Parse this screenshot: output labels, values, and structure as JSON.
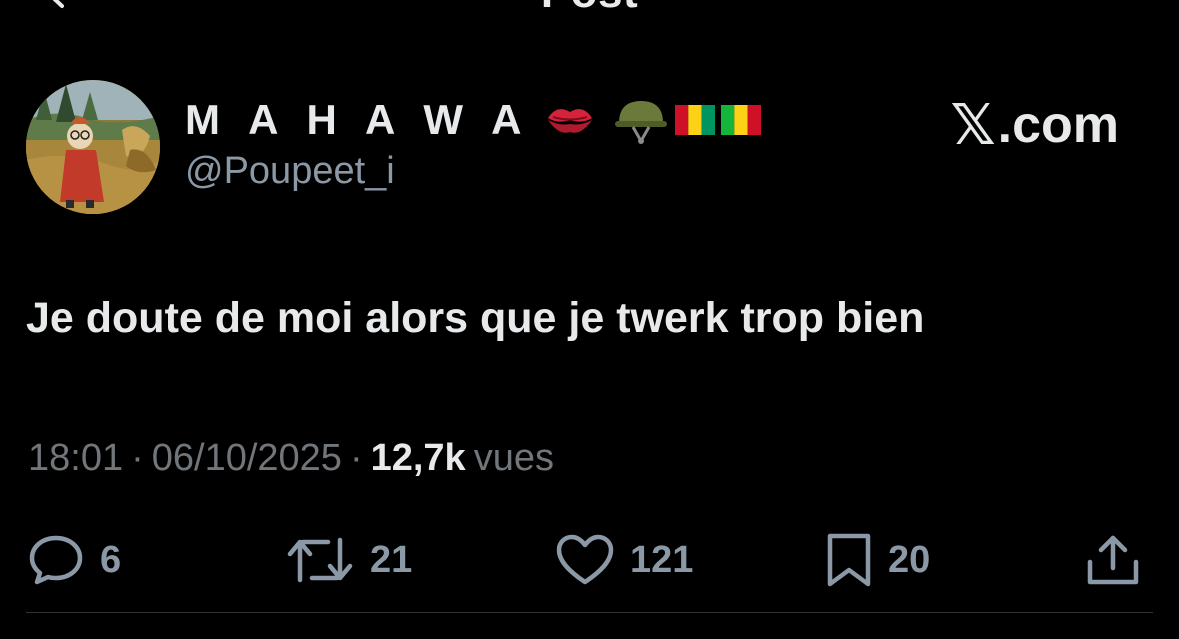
{
  "nav": {
    "title": "Post",
    "back_icon": "chevron-left-icon"
  },
  "author": {
    "display_name": "M A H A W A",
    "emojis": [
      "kiss-mark-icon",
      "military-helmet-icon",
      "guinea-flag-icon",
      "mali-flag-icon"
    ],
    "handle": "@Poupeet_i",
    "avatar": "avatar-illustration"
  },
  "brand": {
    "x_glyph": "𝕏",
    "suffix": ".com"
  },
  "post": {
    "text": "Je doute de moi alors que je twerk trop bien"
  },
  "meta": {
    "time": "18:01",
    "separator": "·",
    "date": "06/10/2025",
    "views_count": "12,7k",
    "views_label": "vues"
  },
  "actions": {
    "reply": {
      "icon": "reply-icon",
      "count": "6"
    },
    "repost": {
      "icon": "repost-icon",
      "count": "21"
    },
    "like": {
      "icon": "heart-icon",
      "count": "121"
    },
    "bookmark": {
      "icon": "bookmark-icon",
      "count": "20"
    },
    "share": {
      "icon": "share-icon"
    }
  },
  "colors": {
    "background": "#000000",
    "text_primary": "#e7e9ea",
    "text_secondary": "#71767b",
    "icon_gray": "#8b98a5",
    "divider": "#2f3336"
  }
}
